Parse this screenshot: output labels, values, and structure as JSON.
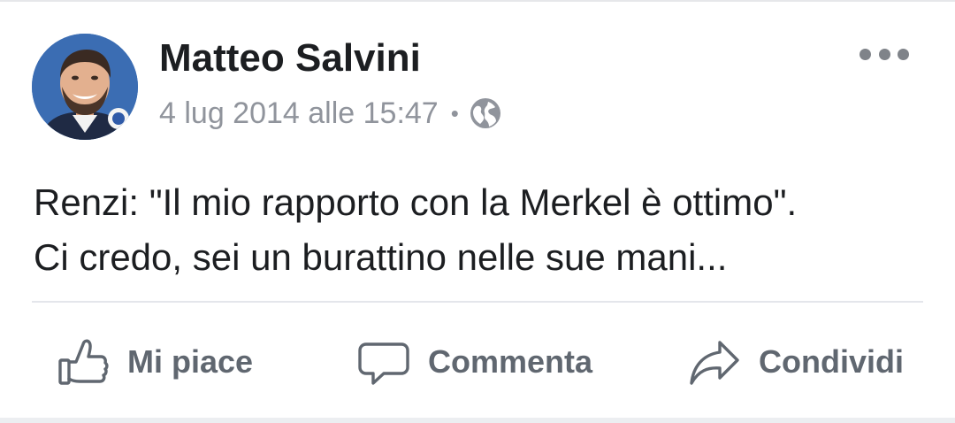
{
  "post": {
    "author": "Matteo Salvini",
    "timestamp": "4 lug 2014 alle 15:47",
    "separator": "•",
    "privacy_icon": "globe-icon",
    "more_icon": "more-options-icon",
    "text_lines": [
      "Renzi: \"Il mio rapporto con la Merkel è ottimo\".",
      "Ci credo, sei un burattino nelle sue mani..."
    ]
  },
  "actions": {
    "like": {
      "label": "Mi piace",
      "icon": "thumbs-up-icon"
    },
    "comment": {
      "label": "Commenta",
      "icon": "comment-bubble-icon"
    },
    "share": {
      "label": "Condividi",
      "icon": "share-arrow-icon"
    }
  },
  "colors": {
    "name_text": "#1c1e21",
    "meta_text": "#90949c",
    "action_text": "#606770",
    "icon_gray": "#606770",
    "divider": "#e4e6eb"
  }
}
